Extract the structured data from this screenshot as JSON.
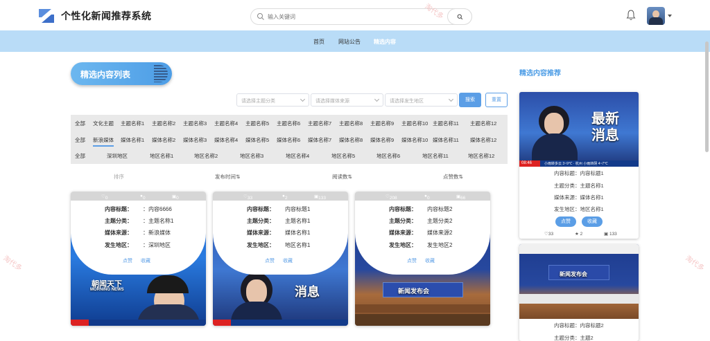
{
  "app": {
    "title": "个性化新闻推荐系统"
  },
  "search": {
    "placeholder": "输入关键词"
  },
  "nav": {
    "items": [
      "首页",
      "网站公告",
      "精选内容"
    ],
    "active_index": 2
  },
  "watermark": "淘代多",
  "list": {
    "title": "精选内容列表"
  },
  "filters": {
    "topic_placeholder": "请选择主题分类",
    "media_placeholder": "请选择媒体来源",
    "region_placeholder": "请选择发生地区",
    "search_label": "搜索",
    "reset_label": "重置"
  },
  "filter_rows": {
    "topics": [
      "全部",
      "文化主题",
      "主题名称1",
      "主题名称2",
      "主题名称3",
      "主题名称4",
      "主题名称5",
      "主题名称6",
      "主题名称7",
      "主题名称8",
      "主题名称9",
      "主题名称10",
      "主题名称11",
      "主题名称12"
    ],
    "media": [
      "全部",
      "新浪媒体",
      "媒体名称1",
      "媒体名称2",
      "媒体名称3",
      "媒体名称4",
      "媒体名称5",
      "媒体名称6",
      "媒体名称7",
      "媒体名称8",
      "媒体名称9",
      "媒体名称10",
      "媒体名称11",
      "媒体名称12"
    ],
    "regions": [
      "全部",
      "深圳地区",
      "地区名称1",
      "地区名称2",
      "地区名称3",
      "地区名称4",
      "地区名称5",
      "地区名称6",
      "地区名称11",
      "地区名称12"
    ]
  },
  "sort": {
    "label": "排序",
    "options": [
      "发布时间",
      "阅读数",
      "点赞数"
    ],
    "sort_icon": "⇅"
  },
  "field_labels": {
    "title": "内容标题：",
    "topic": "主题分类：",
    "media": "媒体来源：",
    "region": "发生地区："
  },
  "actions": {
    "like": "点赞",
    "favorite": "收藏"
  },
  "cards": [
    {
      "likes": "0",
      "favs": "0",
      "reads": "0",
      "title": "：内容6666",
      "topic": "：主题名称1",
      "media": "：新浪媒体",
      "region": "：深圳地区",
      "image_text": "朝闻天下",
      "image_sub": "MORNING NEWS"
    },
    {
      "likes": "33",
      "favs": "2",
      "reads": "133",
      "title": "内容标题1",
      "topic": "主题名称1",
      "media": "媒体名称1",
      "region": "地区名称1",
      "image_text": "消息",
      "image_sub": ""
    },
    {
      "likes": "208",
      "favs": "0",
      "reads": "66",
      "title": "内容标题2",
      "topic": "主题分类2",
      "media": "媒体来源2",
      "region": "发生地区2",
      "image_text": "新闻发布会",
      "image_sub": ""
    }
  ],
  "sidebar": {
    "title": "精选内容推荐",
    "items": [
      {
        "image_text": "最新",
        "image_text2": "消息",
        "time": "08:46",
        "ticker": "小雨转多云 3~9℃ · 杭州 小雨转阴 4~7℃",
        "title": "内容标题：内容标题1",
        "topic": "主题分类：主题名称1",
        "media": "媒体来源：媒体名称1",
        "region": "发生地区：地区名称1",
        "likes": "33",
        "favs": "2",
        "reads": "133"
      },
      {
        "image_text": "新闻发布会",
        "title": "内容标题：内容标题2",
        "topic": "主题分类：主题2"
      }
    ]
  }
}
